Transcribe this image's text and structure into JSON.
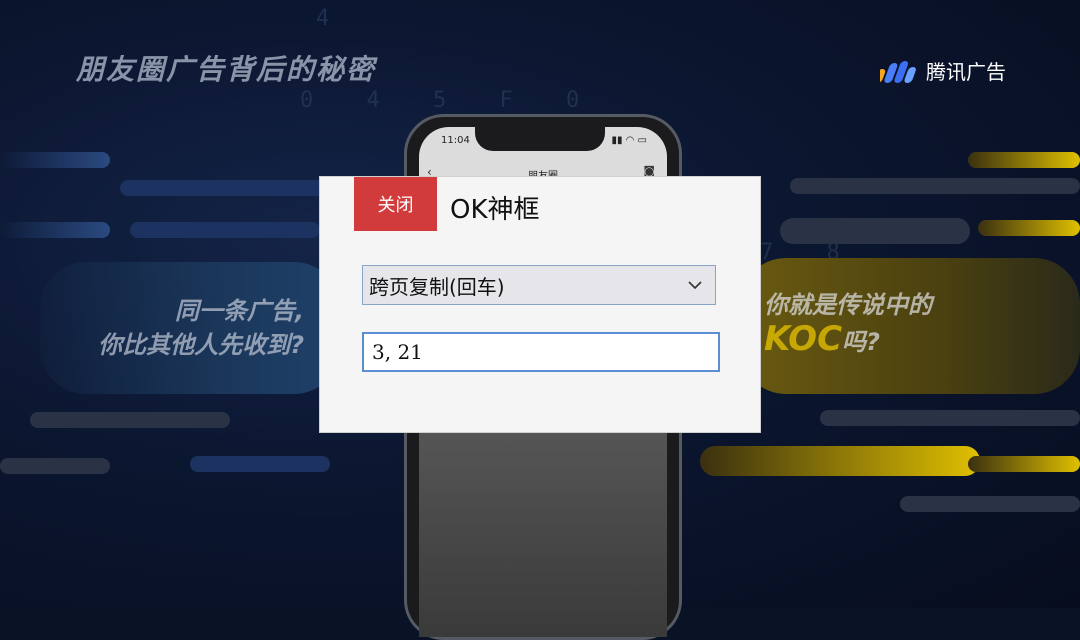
{
  "slide": {
    "title": "朋友圈广告背后的秘密",
    "brand": "腾讯广告",
    "left_slogan_line1": "同一条广告,",
    "left_slogan_line2": "你比其他人先收到?",
    "right_slogan_line1": "你就是传说中的",
    "right_slogan_koc": "KOC",
    "right_slogan_tail": "吗?",
    "bg_digits_1": "4",
    "bg_digits_2": "0 4 5 F 0",
    "bg_digits_3": "7 8"
  },
  "phone": {
    "time": "11:04",
    "status": "",
    "page_title": "朋友圈",
    "back_icon": "chevron-left-icon",
    "camera_icon": "camera-icon"
  },
  "dialog": {
    "close_label": "关闭",
    "title": "OK神框",
    "select_value": "跨页复制(回车)",
    "input_value": "3, 21"
  },
  "colors": {
    "accent_red": "#d23b3b",
    "accent_yellow": "#e0c000",
    "background": "#0a1226"
  }
}
